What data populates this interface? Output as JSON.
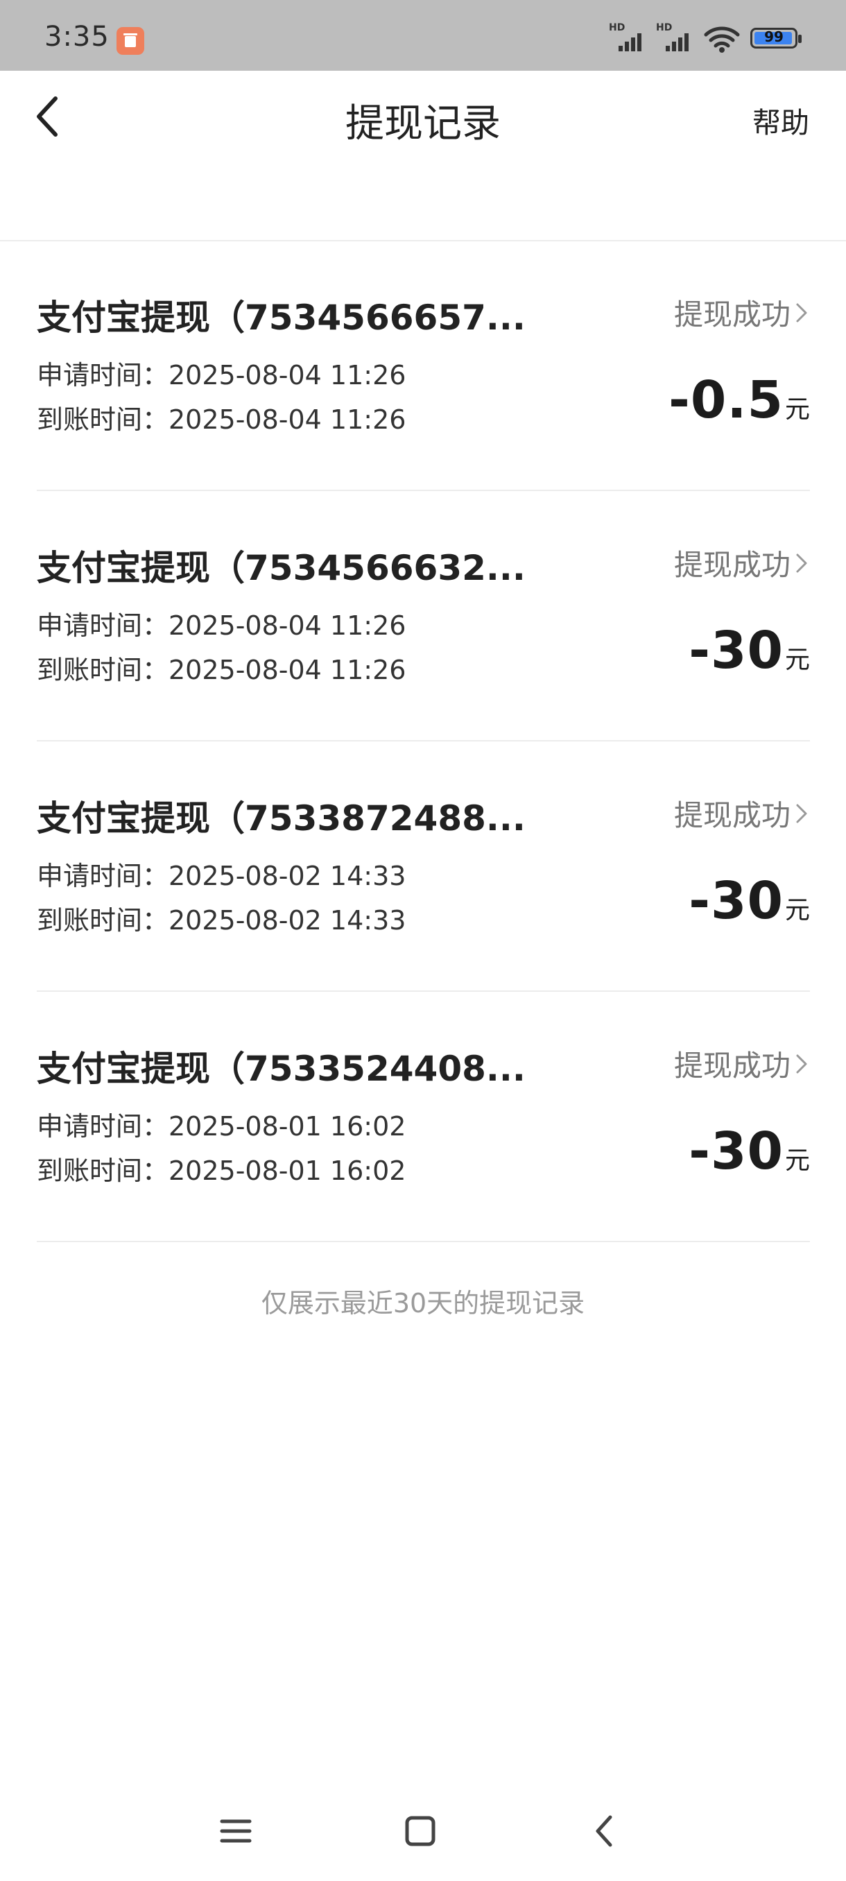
{
  "status_bar": {
    "time": "3:35",
    "signal_1_label": "HD",
    "signal_2_label": "HD",
    "battery_level": "99",
    "icons": [
      "app-notification-icon",
      "signal-icon",
      "signal-icon",
      "wifi-icon",
      "battery-icon"
    ]
  },
  "header": {
    "title": "提现记录",
    "help_label": "帮助",
    "back_icon": "chevron-left-icon"
  },
  "records": [
    {
      "title": "支付宝提现（7534566657...",
      "status": "提现成功",
      "apply_time": "申请时间：2025-08-04 11:26",
      "arrive_time": "到账时间：2025-08-04 11:26",
      "amount": "-0.5",
      "unit": "元"
    },
    {
      "title": "支付宝提现（7534566632...",
      "status": "提现成功",
      "apply_time": "申请时间：2025-08-04 11:26",
      "arrive_time": "到账时间：2025-08-04 11:26",
      "amount": "-30",
      "unit": "元"
    },
    {
      "title": "支付宝提现（7533872488...",
      "status": "提现成功",
      "apply_time": "申请时间：2025-08-02 14:33",
      "arrive_time": "到账时间：2025-08-02 14:33",
      "amount": "-30",
      "unit": "元"
    },
    {
      "title": "支付宝提现（7533524408...",
      "status": "提现成功",
      "apply_time": "申请时间：2025-08-01 16:02",
      "arrive_time": "到账时间：2025-08-01 16:02",
      "amount": "-30",
      "unit": "元"
    }
  ],
  "footer_note": "仅展示最近30天的提现记录",
  "nav_bar": {
    "icons": [
      "menu-icon",
      "home-square-icon",
      "back-icon"
    ]
  },
  "colors": {
    "status_bar_bg": "#bdbdbd",
    "app_icon": "#ef7f5b",
    "battery_fill": "#3c83f0",
    "status_text": "#777777",
    "divider": "#ececec",
    "footer_text": "#9a9a9a"
  }
}
